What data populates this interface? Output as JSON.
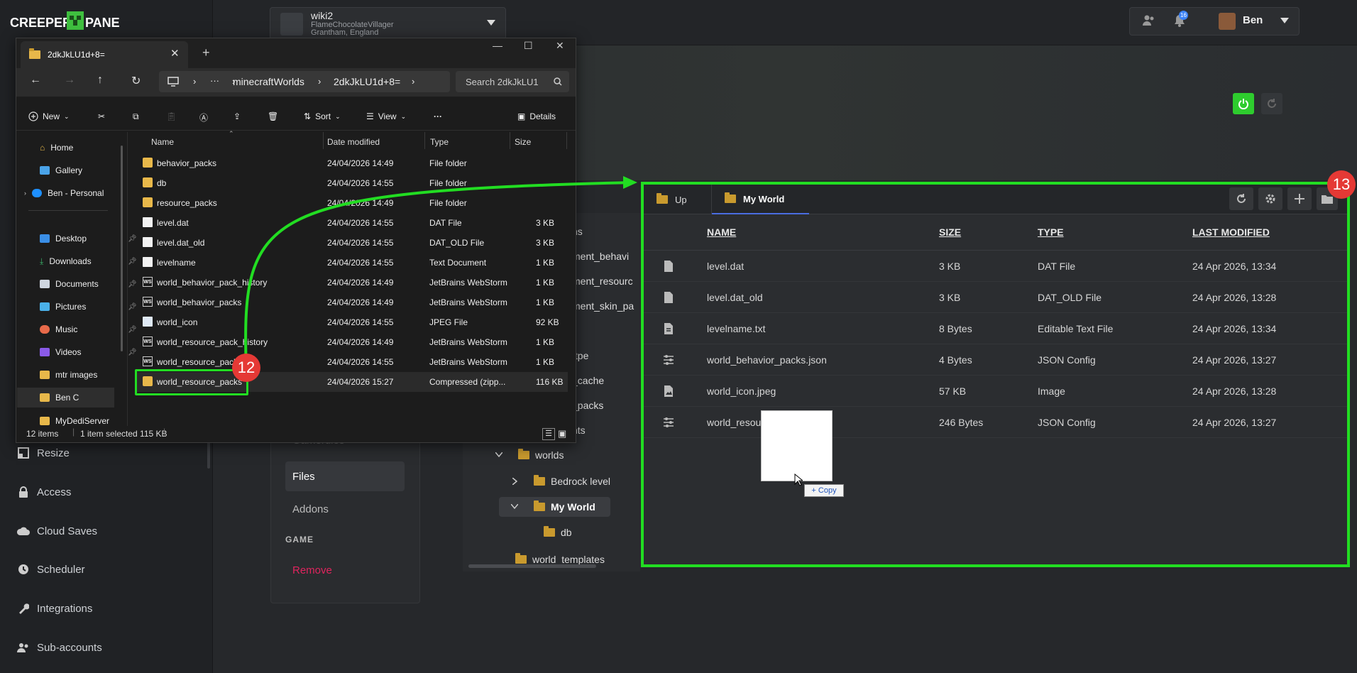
{
  "app": {
    "logo_text": "CREEPERPANEL",
    "logo_left": "CREEPER",
    "logo_right": "PANEL"
  },
  "server": {
    "name": "wiki2",
    "owner": "FlameChocolateVillager",
    "location": "Grantham, England"
  },
  "user": {
    "name": "Ben",
    "notifications": "16"
  },
  "sidebar": {
    "items": [
      {
        "label": "Resize",
        "icon": "resize-icon"
      },
      {
        "label": "Access",
        "icon": "lock-icon"
      },
      {
        "label": "Cloud Saves",
        "icon": "cloud-icon"
      },
      {
        "label": "Scheduler",
        "icon": "clock-icon"
      },
      {
        "label": "Integrations",
        "icon": "wrench-icon"
      },
      {
        "label": "Sub-accounts",
        "icon": "users-icon"
      }
    ]
  },
  "midnav": {
    "partial_top": "Gamerules",
    "files": "Files",
    "addons": "Addons",
    "section_game": "GAME",
    "remove": "Remove"
  },
  "tree": {
    "fragments": [
      "ns",
      "ment_behavi",
      "ment_resourc",
      "ment_skin_pa",
      "ftpe",
      "_cache",
      "_packs",
      "nts"
    ],
    "items": [
      {
        "label": "worlds"
      },
      {
        "label": "Bedrock level"
      },
      {
        "label": "My World"
      },
      {
        "label": "db"
      },
      {
        "label": "world_templates"
      }
    ]
  },
  "file_manager": {
    "tabs": [
      {
        "label": "Up"
      },
      {
        "label": "My World"
      }
    ],
    "columns": [
      "NAME",
      "SIZE",
      "TYPE",
      "LAST MODIFIED"
    ],
    "rows": [
      {
        "name": "level.dat",
        "size": "3 KB",
        "type": "DAT File",
        "modified": "24 Apr 2026, 13:34",
        "icon": "file-icon"
      },
      {
        "name": "level.dat_old",
        "size": "3 KB",
        "type": "DAT_OLD File",
        "modified": "24 Apr 2026, 13:28",
        "icon": "file-icon"
      },
      {
        "name": "levelname.txt",
        "size": "8 Bytes",
        "type": "Editable Text File",
        "modified": "24 Apr 2026, 13:34",
        "icon": "text-file-icon"
      },
      {
        "name": "world_behavior_packs.json",
        "size": "4 Bytes",
        "type": "JSON Config",
        "modified": "24 Apr 2026, 13:27",
        "icon": "config-icon"
      },
      {
        "name": "world_icon.jpeg",
        "size": "57 KB",
        "type": "Image",
        "modified": "24 Apr 2026, 13:28",
        "icon": "image-file-icon"
      },
      {
        "name": "world_resou",
        "size": "246 Bytes",
        "type": "JSON Config",
        "modified": "24 Apr 2026, 13:27",
        "icon": "config-icon"
      }
    ],
    "copy_tooltip": "+ Copy"
  },
  "explorer": {
    "tab_title": "2dkJkLU1d+8=",
    "breadcrumb": [
      "minecraftWorlds",
      "2dkJkLU1d+8="
    ],
    "ellipsis": "···",
    "search_placeholder": "Search 2dkJkLU1",
    "commands": {
      "new": "New",
      "sort": "Sort",
      "view": "View",
      "details": "Details"
    },
    "nav": [
      {
        "label": "Home"
      },
      {
        "label": "Gallery"
      },
      {
        "label": "Ben - Personal"
      },
      {
        "label": "Desktop"
      },
      {
        "label": "Downloads"
      },
      {
        "label": "Documents"
      },
      {
        "label": "Pictures"
      },
      {
        "label": "Music"
      },
      {
        "label": "Videos"
      },
      {
        "label": "mtr images"
      },
      {
        "label": "Ben C"
      },
      {
        "label": "MyDediServer"
      }
    ],
    "columns": [
      "Name",
      "Date modified",
      "Type",
      "Size"
    ],
    "rows": [
      {
        "name": "behavior_packs",
        "date": "24/04/2026 14:49",
        "type": "File folder",
        "size": "",
        "kind": "folder"
      },
      {
        "name": "db",
        "date": "24/04/2026 14:55",
        "type": "File folder",
        "size": "",
        "kind": "folder"
      },
      {
        "name": "resource_packs",
        "date": "24/04/2026 14:49",
        "type": "File folder",
        "size": "",
        "kind": "folder"
      },
      {
        "name": "level.dat",
        "date": "24/04/2026 14:55",
        "type": "DAT File",
        "size": "3 KB",
        "kind": "doc"
      },
      {
        "name": "level.dat_old",
        "date": "24/04/2026 14:55",
        "type": "DAT_OLD File",
        "size": "3 KB",
        "kind": "doc"
      },
      {
        "name": "levelname",
        "date": "24/04/2026 14:55",
        "type": "Text Document",
        "size": "1 KB",
        "kind": "doc"
      },
      {
        "name": "world_behavior_pack_history",
        "date": "24/04/2026 14:49",
        "type": "JetBrains WebStorm",
        "size": "1 KB",
        "kind": "ws"
      },
      {
        "name": "world_behavior_packs",
        "date": "24/04/2026 14:49",
        "type": "JetBrains WebStorm",
        "size": "1 KB",
        "kind": "ws"
      },
      {
        "name": "world_icon",
        "date": "24/04/2026 14:55",
        "type": "JPEG File",
        "size": "92 KB",
        "kind": "doc"
      },
      {
        "name": "world_resource_pack_history",
        "date": "24/04/2026 14:49",
        "type": "JetBrains WebStorm",
        "size": "1 KB",
        "kind": "ws"
      },
      {
        "name": "world_resource_pack",
        "date": "24/04/2026 14:55",
        "type": "JetBrains WebStorm",
        "size": "1 KB",
        "kind": "ws"
      },
      {
        "name": "world_resource_packs",
        "date": "24/04/2026 15:27",
        "type": "Compressed (zipp...",
        "size": "116 KB",
        "kind": "zip"
      }
    ],
    "status": {
      "items": "12 items",
      "selected": "1 item selected  115 KB"
    }
  },
  "annotations": {
    "step_a": "12",
    "step_b": "13"
  },
  "colors": {
    "highlight": "#22dd22",
    "badge": "#e53935",
    "power": "#2ecc2e",
    "remove": "#e0245e"
  }
}
